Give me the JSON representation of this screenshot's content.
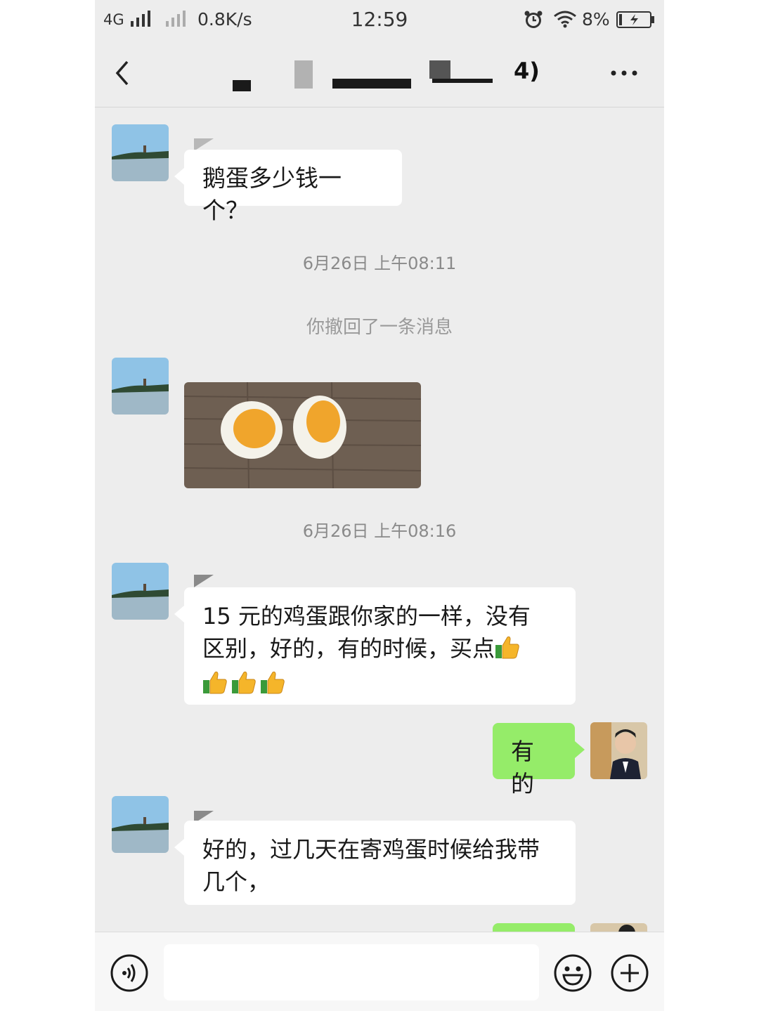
{
  "status_bar": {
    "network": "4G",
    "speed": "0.8K/s",
    "time": "12:59",
    "battery": "8%",
    "icons": [
      "signal-icon",
      "signal-weak-icon",
      "alarm-icon",
      "wifi-icon",
      "battery-charging-icon"
    ]
  },
  "header": {
    "title_visible": "4)",
    "icons": [
      "back-arrow-icon",
      "more-icon"
    ]
  },
  "messages": [
    {
      "side": "left",
      "type": "text",
      "text": "鹅蛋多少钱一个？"
    },
    {
      "type": "timestamp",
      "text": "6月26日 上午08:11"
    },
    {
      "type": "system",
      "text": "你撤回了一条消息"
    },
    {
      "side": "left",
      "type": "image",
      "image": "two-halved-boiled-eggs"
    },
    {
      "type": "timestamp",
      "text": "6月26日 上午08:16"
    },
    {
      "side": "left",
      "type": "text",
      "line1": "15 元的鸡蛋跟你家的一样，没有",
      "line2": "区别，好的，有的时候，买点",
      "emoji": "thumbs-up"
    },
    {
      "side": "right",
      "type": "text",
      "text": "有的"
    },
    {
      "side": "left",
      "type": "text",
      "line1": "好的，过几天在寄鸡蛋时候给我带",
      "line2": "几个，"
    }
  ],
  "input_bar": {
    "placeholder": "",
    "icons": [
      "voice-icon",
      "emoji-icon",
      "plus-icon"
    ]
  },
  "colors": {
    "background": "#ededed",
    "bubble_left": "#ffffff",
    "bubble_right": "#95ec69",
    "timestamp": "#8a8a8a"
  }
}
